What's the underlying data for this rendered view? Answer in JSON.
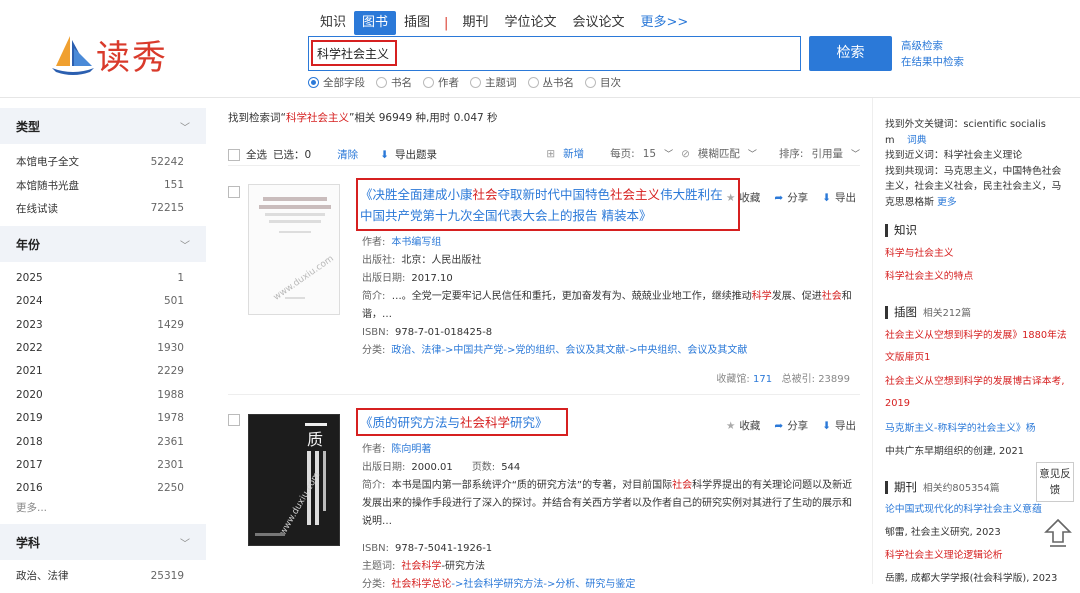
{
  "logo_text": "读秀",
  "nav": {
    "tabs": [
      "知识",
      "图书",
      "插图",
      "期刊",
      "学位论文",
      "会议论文"
    ],
    "active": "图书",
    "more": "更多>>"
  },
  "search": {
    "value": "科学社会主义",
    "button": "检索",
    "advanced": "高级检索",
    "within": "在结果中检索"
  },
  "fields": [
    "全部字段",
    "书名",
    "作者",
    "主题词",
    "丛书名",
    "目次"
  ],
  "sidebar": {
    "type_title": "类型",
    "types": [
      {
        "label": "本馆电子全文",
        "count": "52242"
      },
      {
        "label": "本馆随书光盘",
        "count": "151"
      },
      {
        "label": "在线试读",
        "count": "72215"
      }
    ],
    "year_title": "年份",
    "years": [
      {
        "label": "2025",
        "count": "1"
      },
      {
        "label": "2024",
        "count": "501"
      },
      {
        "label": "2023",
        "count": "1429"
      },
      {
        "label": "2022",
        "count": "1930"
      },
      {
        "label": "2021",
        "count": "2229"
      },
      {
        "label": "2020",
        "count": "1988"
      },
      {
        "label": "2019",
        "count": "1978"
      },
      {
        "label": "2018",
        "count": "2361"
      },
      {
        "label": "2017",
        "count": "2301"
      },
      {
        "label": "2016",
        "count": "2250"
      }
    ],
    "more": "更多...",
    "subject_title": "学科",
    "subjects": [
      {
        "label": "政治、法律",
        "count": "25319"
      }
    ]
  },
  "results": {
    "summary_prefix": "找到检索词“",
    "summary_keyword": "科学社会主义",
    "summary_suffix": "”相关 96949 种,用时 0.047 秒",
    "toolbar": {
      "select_all": "全选",
      "selected": "已选：0",
      "clear": "清除",
      "export": "导出题录",
      "add": "新增",
      "per_page_label": "每页:",
      "per_page": "15",
      "fuzzy": "模糊匹配",
      "sort_label": "排序:",
      "sort": "引用量"
    },
    "actions": {
      "collect": "收藏",
      "share": "分享",
      "export": "导出"
    },
    "books": [
      {
        "title_parts": [
          "《决胜全面建成小康",
          "社会",
          "夺取新时代中国特色",
          "社会主义",
          "伟大胜利在中国共产党第十九次全国代表大会上的报告 精装本》"
        ],
        "author_label": "作者:",
        "author": "本书编写组",
        "publisher_label": "出版社:",
        "publisher": "北京：人民出版社",
        "date_label": "出版日期:",
        "date": "2017.10",
        "intro_label": "简介:",
        "intro_parts": [
          "…。全党一定要牢记人民信任和重托，更加奋发有为、兢兢业业地工作，继续推动",
          "科学",
          "发展、促进",
          "社会",
          "和谐，…"
        ],
        "isbn_label": "ISBN:",
        "isbn": "978-7-01-018425-8",
        "class_label": "分类:",
        "class": "政治、法律->中国共产党->党的组织、会议及其文献->中央组织、会议及其文献",
        "collect_label": "收藏馆:",
        "collect_count": "171",
        "cite_label": "总被引:",
        "cite_count": "23899"
      },
      {
        "title_parts": [
          "《质的研究方法与",
          "社会科学",
          "研究》"
        ],
        "author_label": "作者:",
        "author": "陈向明著",
        "date_label": "出版日期:",
        "date": "2000.01",
        "pages_label": "页数:",
        "pages": "544",
        "intro_label": "简介:",
        "intro_parts": [
          "本书是国内第一部系统评介“质的研究方法”的专著，对目前国际",
          "社会",
          "科学界提出的有关理论问题以及新近发展出来的操作手段进行了深入的探讨。并结合有关西方学者以及作者自己的研究实例对其进行了生动的展示和说明…"
        ],
        "isbn_label": "ISBN:",
        "isbn": "978-7-5041-1926-1",
        "subject_label": "主题词:",
        "subject_hl": "社会科学",
        "subject_rest": "-研究方法",
        "class_label": "分类:",
        "class_parts": [
          "社会科学总论",
          "->社会科学研究方法->分析、研究与鉴定"
        ]
      }
    ]
  },
  "right": {
    "foreign_label": "找到外文关键词：",
    "foreign_value": "scientific socialism",
    "dict": "词典",
    "near_label": "找到近义词：",
    "near_value": "科学社会主义理论",
    "co_label": "找到共现词：",
    "co_value": "马克思主义，中国特色社会主义，社会主义社会，民主社会主义，马克思恩格斯",
    "more": "更多",
    "knowledge_title": "知识",
    "knowledge": [
      "科学与社会主义",
      "科学社会主义的特点"
    ],
    "illus_title": "插图",
    "illus_count": "相关212篇",
    "illus": [
      {
        "a": "社会主义从空想到科学的发展》1880年法文版扉页1"
      },
      {
        "a": "社会主义从空想到科学的发展博古译本考, 2019"
      },
      {
        "a": "马克斯主义-称科学的社会主义》杨",
        "b": "中共广东早期组织的创建, 2021"
      }
    ],
    "journal_title": "期刊",
    "journal_count": "相关约805354篇",
    "journals": [
      {
        "a": "论中国式现代化的科学社会主义意蕴",
        "b": "郇雷, 社会主义研究, 2023"
      },
      {
        "a": "科学社会主义理论逻辑论析",
        "b": "岳鹏, 成都大学学报(社会科学版), 2023"
      }
    ]
  },
  "feedback": "意见反馈"
}
